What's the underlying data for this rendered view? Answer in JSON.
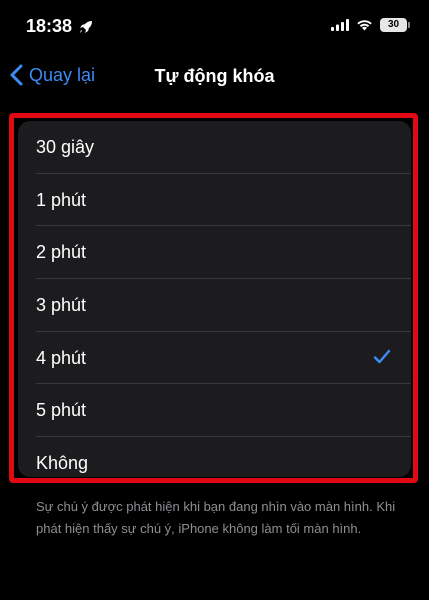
{
  "status_bar": {
    "time": "18:38",
    "battery_level": "30"
  },
  "nav": {
    "back_label": "Quay lại",
    "title": "Tự động khóa"
  },
  "options": [
    {
      "label": "30 giây",
      "selected": false
    },
    {
      "label": "1 phút",
      "selected": false
    },
    {
      "label": "2 phút",
      "selected": false
    },
    {
      "label": "3 phút",
      "selected": false
    },
    {
      "label": "4 phút",
      "selected": true
    },
    {
      "label": "5 phút",
      "selected": false
    },
    {
      "label": "Không",
      "selected": false
    }
  ],
  "footer_note": "Sự chú ý được phát hiện khi bạn đang nhìn vào màn hình. Khi phát hiện thấy sự chú ý, iPhone không làm tối màn hình.",
  "colors": {
    "accent": "#3d8bf5",
    "highlight": "#e10a14",
    "card_background": "#1c1c1e",
    "background": "#000000"
  }
}
